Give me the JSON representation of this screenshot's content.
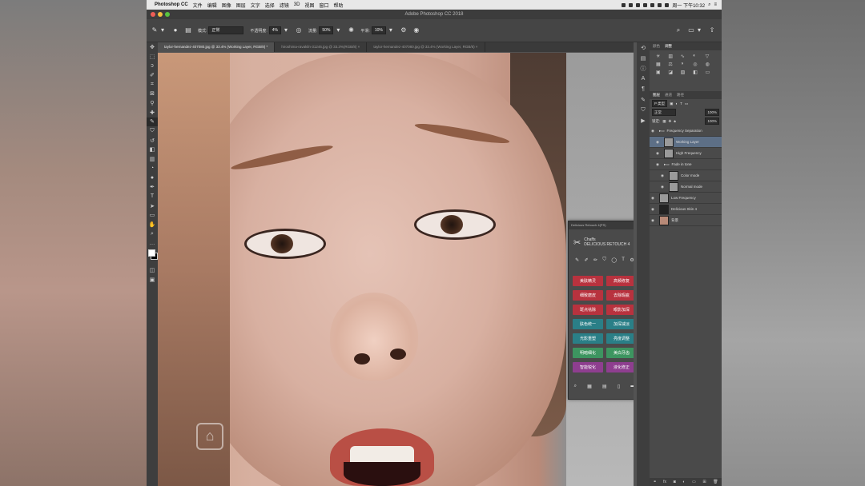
{
  "menubar": {
    "app_name": "Photoshop CC",
    "items": [
      "文件",
      "编辑",
      "图像",
      "图层",
      "文字",
      "选择",
      "滤镜",
      "3D",
      "视图",
      "窗口",
      "帮助"
    ],
    "clock": "周一 下午10:32"
  },
  "window": {
    "title": "Adobe Photoshop CC 2018"
  },
  "options": {
    "mode_label": "模式:",
    "mode_value": "正常",
    "opacity_label": "不透明度:",
    "opacity_value": "4%",
    "flow_label": "流量:",
    "flow_value": "50%",
    "smooth_label": "平滑:",
    "smooth_value": "10%"
  },
  "doc_tabs": [
    {
      "label": "taylor-hernandez-407080.jpg @ 33.4% (Working Layer, RGB/8) *",
      "active": true
    },
    {
      "label": "hiroshima-ravakiln-31246.jpg @ 33.3%(RGB/8) ×",
      "active": false
    },
    {
      "label": "taylor-hernandez-407080.jpg @ 33.4% (Working Layer, RGB/8) ×",
      "active": false
    }
  ],
  "plugin": {
    "title": "Delicious Retouch 4(PS)",
    "brand_line1": "Chaffs",
    "brand_line2": "DELICIOUS RETOUCH 4",
    "buttons": [
      {
        "label": "美肤精灵",
        "color": "#b8323e"
      },
      {
        "label": "高频修复",
        "color": "#b8323e"
      },
      {
        "label": "细致磨皮",
        "color": "#b8323e"
      },
      {
        "label": "去除瑕疵",
        "color": "#b8323e"
      },
      {
        "label": "斑点祛除",
        "color": "#b8323e"
      },
      {
        "label": "眼影加深",
        "color": "#b8323e"
      },
      {
        "label": "肤色统一",
        "color": "#2a7f87"
      },
      {
        "label": "加深减淡",
        "color": "#2a7f87"
      },
      {
        "label": "光影重塑",
        "color": "#2a7f87"
      },
      {
        "label": "亮度调整",
        "color": "#2a7f87"
      },
      {
        "label": "明暗细化",
        "color": "#3d9560"
      },
      {
        "label": "美白牙齿",
        "color": "#3d9560"
      },
      {
        "label": "智能锐化",
        "color": "#8e3e8f"
      },
      {
        "label": "液化修正",
        "color": "#8e3e8f"
      }
    ]
  },
  "panels": {
    "top_tabs": [
      "颜色",
      "调整"
    ],
    "layer_tabs": [
      "图层",
      "通道",
      "路径"
    ],
    "kind_label": "P 类型",
    "blend_mode": "正常",
    "opacity": "100%",
    "lock_label": "锁定:",
    "fill": "100%",
    "layers": [
      {
        "name": "Frequency Separation",
        "kind": "group",
        "selected": false,
        "indent": 0
      },
      {
        "name": "Working Layer",
        "kind": "layer",
        "selected": true,
        "indent": 1
      },
      {
        "name": "High Frequency",
        "kind": "layer",
        "selected": false,
        "indent": 1
      },
      {
        "name": "Fade in tone",
        "kind": "group",
        "selected": false,
        "indent": 1
      },
      {
        "name": "Color mode",
        "kind": "layer",
        "selected": false,
        "indent": 2
      },
      {
        "name": "Normal mode",
        "kind": "layer",
        "selected": false,
        "indent": 2
      },
      {
        "name": "Low Frequency",
        "kind": "layer",
        "selected": false,
        "indent": 0
      },
      {
        "name": "Delicious Skin 4",
        "kind": "mask",
        "selected": false,
        "indent": 0
      },
      {
        "name": "背景",
        "kind": "background",
        "selected": false,
        "indent": 0
      }
    ]
  },
  "colors": {
    "foreground": "#ffffff",
    "background": "#000000",
    "selected_layer": "#5d6f86"
  }
}
